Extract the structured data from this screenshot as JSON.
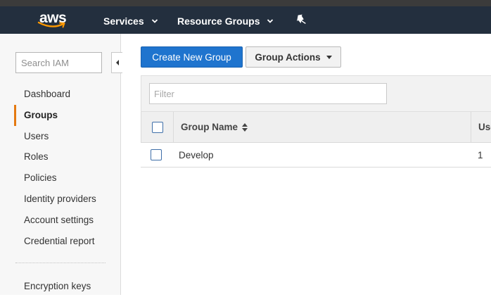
{
  "header": {
    "logo_text": "aws",
    "nav": [
      {
        "label": "Services",
        "icon": "chevron-down-icon"
      },
      {
        "label": "Resource Groups",
        "icon": "chevron-down-icon"
      }
    ],
    "pin_icon": "pin-icon",
    "colors": {
      "background": "#232f3e",
      "logo_smile": "#ff9900"
    }
  },
  "sidebar": {
    "search_placeholder": "Search IAM",
    "collapse_icon": "caret-left-icon",
    "items": [
      {
        "label": "Dashboard",
        "active": false
      },
      {
        "label": "Groups",
        "active": true
      },
      {
        "label": "Users",
        "active": false
      },
      {
        "label": "Roles",
        "active": false
      },
      {
        "label": "Policies",
        "active": false
      },
      {
        "label": "Identity providers",
        "active": false
      },
      {
        "label": "Account settings",
        "active": false
      },
      {
        "label": "Credential report",
        "active": false
      }
    ],
    "bottom_item": "Encryption keys",
    "active_color": "#e47911"
  },
  "toolbar": {
    "create_label": "Create New Group",
    "actions_label": "Group Actions",
    "primary_color": "#1f74ce"
  },
  "filter": {
    "placeholder": "Filter"
  },
  "table": {
    "columns": [
      "Group Name",
      "Users"
    ],
    "rows": [
      {
        "name": "Develop",
        "users": "1"
      }
    ]
  }
}
